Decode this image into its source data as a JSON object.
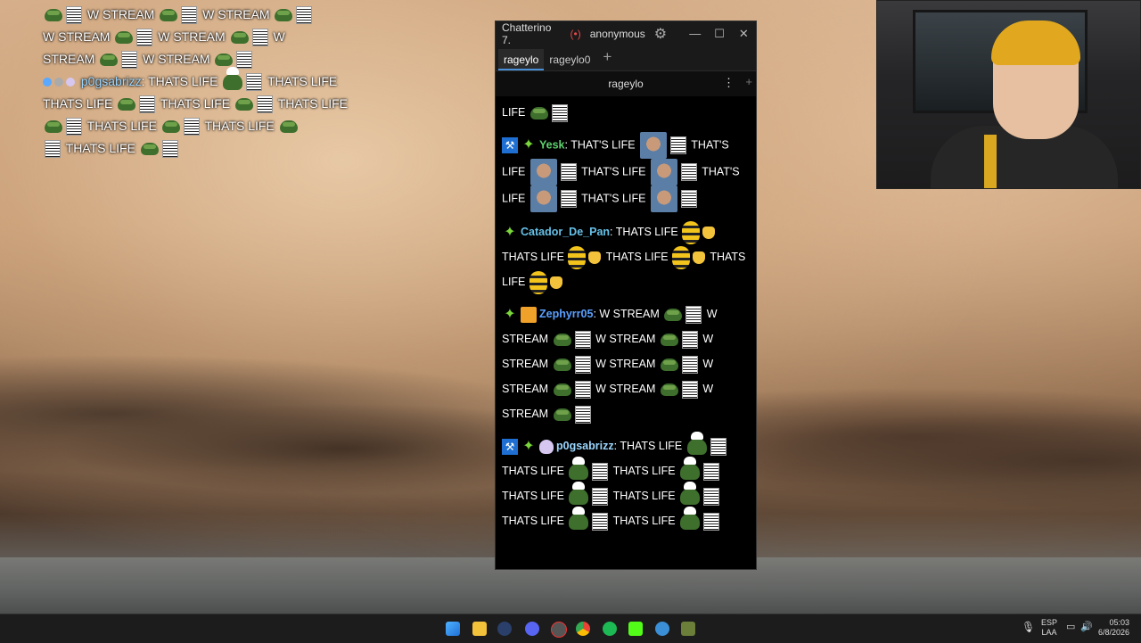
{
  "overlay": {
    "lines": [
      "W STREAM",
      "W STREAM",
      "W STREAM",
      "W STREAM",
      "W",
      "STREAM",
      "W STREAM"
    ],
    "p0g_user": "p0gsabrizz",
    "p0g_text": "THATS LIFE"
  },
  "chatterino": {
    "title": "Chatterino 7.",
    "user": "anonymous",
    "tabs": [
      "rageylo",
      "rageylo0"
    ],
    "channel": "rageylo"
  },
  "messages": {
    "partial_top": "LIFE",
    "yesk": {
      "name": "Yesk",
      "t1": "THAT'S LIFE",
      "t2": "THAT'S",
      "t3": "LIFE",
      "t4": "THAT'S LIFE",
      "t5": "THAT'S LIFE",
      "t6": "THAT'S LIFE"
    },
    "catador": {
      "name": "Catador_De_Pan",
      "t1": "THATS LIFE",
      "t2": "THATS LIFE",
      "t3": "THATS LIFE",
      "t4": "THATS LIFE"
    },
    "zeph": {
      "name": "Zephyrr05",
      "t1": "W STREAM",
      "w": "W",
      "stream": "STREAM",
      "ws": "W STREAM"
    },
    "p0g": {
      "name": "p0gsabrizz",
      "t1": "THATS LIFE",
      "t2": "THATS LIFE",
      "t3": "THATS LIFE",
      "t4": "THATS LIFE",
      "t5": "THATS LIFE",
      "t6": "THATS LIFE",
      "t7": "THATS",
      "t8": "LIFE"
    }
  },
  "taskbar": {
    "lang_top": "ESP",
    "lang_bottom": "LAA",
    "time": "05:03",
    "date": "6/8/2026"
  }
}
